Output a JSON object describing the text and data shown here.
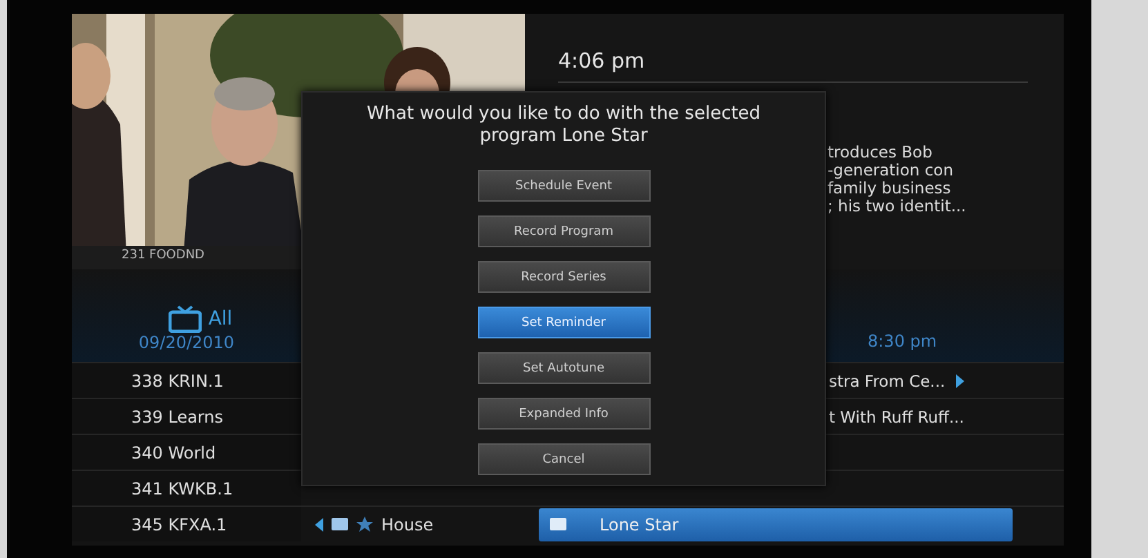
{
  "preview": {
    "channel_caption": "231 FOODND"
  },
  "clock": "4:06 pm",
  "description_lines": [
    "troduces Bob",
    "-generation con",
    "family business",
    "; his two identit..."
  ],
  "filter": {
    "label": "All",
    "date": "09/20/2010"
  },
  "time_header": "8:30 pm",
  "rows": [
    {
      "channel": "338 KRIN.1",
      "program": "stra From Ce...",
      "more": true,
      "selected": false
    },
    {
      "channel": "339 Learns",
      "program": "t With Ruff Ruff...",
      "more": false,
      "selected": false
    },
    {
      "channel": "340 World",
      "more": false,
      "selected": false
    },
    {
      "channel": "341 KWKB.1",
      "more": false,
      "selected": false
    },
    {
      "channel": "345 KFXA.1",
      "current": "House",
      "program": "Lone Star",
      "more": false,
      "selected": true
    }
  ],
  "dialog": {
    "title": "What would you like to do with the selected program Lone Star",
    "buttons": [
      {
        "label": "Schedule Event",
        "selected": false
      },
      {
        "label": "Record Program",
        "selected": false
      },
      {
        "label": "Record Series",
        "selected": false
      },
      {
        "label": "Set Reminder",
        "selected": true
      },
      {
        "label": "Set Autotune",
        "selected": false
      },
      {
        "label": "Expanded Info",
        "selected": false
      },
      {
        "label": "Cancel",
        "selected": false
      }
    ]
  }
}
